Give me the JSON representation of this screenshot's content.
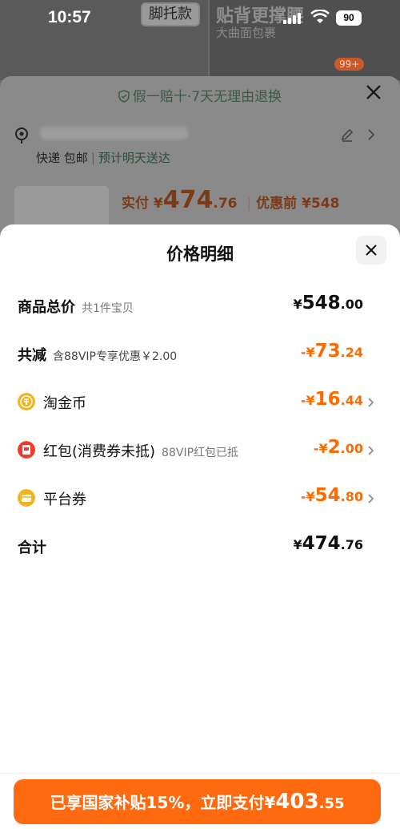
{
  "status_bar": {
    "time": "10:57",
    "battery": "90"
  },
  "background": {
    "promo_tag": "脚托款",
    "promo_title": "贴背更撑腰",
    "promo_sub": "大曲面包裹",
    "cart_badge": "99+",
    "guarantee": "假一赔十·7天无理由退换",
    "shipping": {
      "method": "快递",
      "fee": "包邮",
      "eta": "预计明天送达"
    },
    "paid": {
      "label": "实付",
      "currency": "¥",
      "integer": "474",
      "decimal": ".76",
      "before_label": "优惠前",
      "before_price": "¥548"
    }
  },
  "sheet": {
    "title": "价格明细",
    "rows": [
      {
        "label": "商品总价",
        "sub": "共1件宝贝",
        "cur": "¥",
        "int": "548",
        "dec": ".00"
      },
      {
        "label": "共减",
        "sub": "含88VIP专享优惠￥2.00",
        "cur": "-¥",
        "int": "73",
        "dec": ".24"
      },
      {
        "label": "淘金币",
        "sub": "",
        "cur": "-¥",
        "int": "16",
        "dec": ".44",
        "icon": "taojinbi-coin-icon"
      },
      {
        "label": "红包(消费券未抵)",
        "sub": "88VIP红包已抵",
        "cur": "-¥",
        "int": "2",
        "dec": ".00",
        "icon": "red-packet-icon"
      },
      {
        "label": "平台券",
        "sub": "",
        "cur": "-¥",
        "int": "54",
        "dec": ".80",
        "icon": "coupon-icon"
      },
      {
        "label": "合计",
        "sub": "",
        "cur": "¥",
        "int": "474",
        "dec": ".76"
      }
    ]
  },
  "pay_button": {
    "prefix": "已享国家补贴15%，立即支付",
    "cur": "¥",
    "int": "403",
    "dec": ".55"
  },
  "colors": {
    "accent": "#ff6a00",
    "button": "#ff6a10"
  }
}
